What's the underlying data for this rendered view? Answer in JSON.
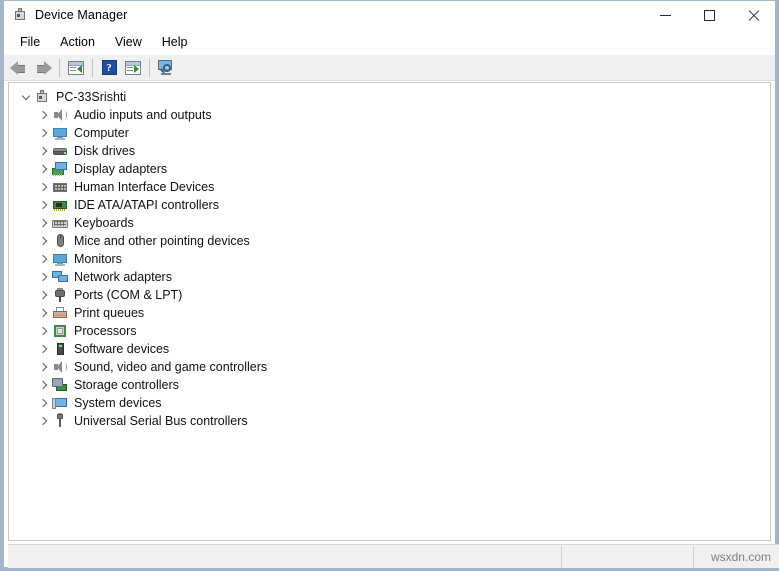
{
  "window": {
    "title": "Device Manager",
    "icon": "device-manager-icon",
    "controls": {
      "minimize": "Minimize",
      "maximize": "Maximize",
      "close": "Close"
    }
  },
  "menubar": {
    "items": [
      {
        "label": "File"
      },
      {
        "label": "Action"
      },
      {
        "label": "View"
      },
      {
        "label": "Help"
      }
    ]
  },
  "toolbar": {
    "buttons": [
      {
        "name": "back-button",
        "icon": "back-arrow-icon",
        "tooltip": "Back"
      },
      {
        "name": "forward-button",
        "icon": "forward-arrow-icon",
        "tooltip": "Forward"
      },
      {
        "name": "properties-button",
        "icon": "properties-icon",
        "tooltip": "Properties"
      },
      {
        "name": "help-button",
        "icon": "help-question-icon",
        "label": "?",
        "tooltip": "Help"
      },
      {
        "name": "update-driver-button",
        "icon": "window-play-icon",
        "tooltip": "Update driver"
      },
      {
        "name": "scan-hardware-changes-button",
        "icon": "scan-monitor-icon",
        "tooltip": "Scan for hardware changes"
      }
    ]
  },
  "tree": {
    "root": {
      "label": "PC-33Srishti",
      "icon": "computer-root-icon",
      "expanded": true
    },
    "items": [
      {
        "label": "Audio inputs and outputs",
        "icon": "speaker-icon",
        "expanded": false
      },
      {
        "label": "Computer",
        "icon": "monitor-icon",
        "expanded": false
      },
      {
        "label": "Disk drives",
        "icon": "disk-drive-icon",
        "expanded": false
      },
      {
        "label": "Display adapters",
        "icon": "display-adapter-icon",
        "expanded": false
      },
      {
        "label": "Human Interface Devices",
        "icon": "hid-icon",
        "expanded": false
      },
      {
        "label": "IDE ATA/ATAPI controllers",
        "icon": "ide-controller-icon",
        "expanded": false
      },
      {
        "label": "Keyboards",
        "icon": "keyboard-icon",
        "expanded": false
      },
      {
        "label": "Mice and other pointing devices",
        "icon": "mouse-icon",
        "expanded": false
      },
      {
        "label": "Monitors",
        "icon": "monitor-icon",
        "expanded": false
      },
      {
        "label": "Network adapters",
        "icon": "network-adapter-icon",
        "expanded": false
      },
      {
        "label": "Ports (COM & LPT)",
        "icon": "port-plug-icon",
        "expanded": false
      },
      {
        "label": "Print queues",
        "icon": "printer-icon",
        "expanded": false
      },
      {
        "label": "Processors",
        "icon": "processor-icon",
        "expanded": false
      },
      {
        "label": "Software devices",
        "icon": "software-device-icon",
        "expanded": false
      },
      {
        "label": "Sound, video and game controllers",
        "icon": "speaker-icon",
        "expanded": false
      },
      {
        "label": "Storage controllers",
        "icon": "storage-controller-icon",
        "expanded": false
      },
      {
        "label": "System devices",
        "icon": "system-device-icon",
        "expanded": false
      },
      {
        "label": "Universal Serial Bus controllers",
        "icon": "usb-icon",
        "expanded": false
      }
    ]
  },
  "statusbar": {
    "pane1": "",
    "pane2": "",
    "watermark": "wsxdn.com"
  },
  "colors": {
    "window_border": "#a3b5c7",
    "toolbar_bg": "#f0f0f0",
    "statusbar_bg": "#f0f0f0",
    "tree_bg": "#ffffff",
    "help_icon_blue": "#1f4e9c",
    "text": "#111111"
  }
}
